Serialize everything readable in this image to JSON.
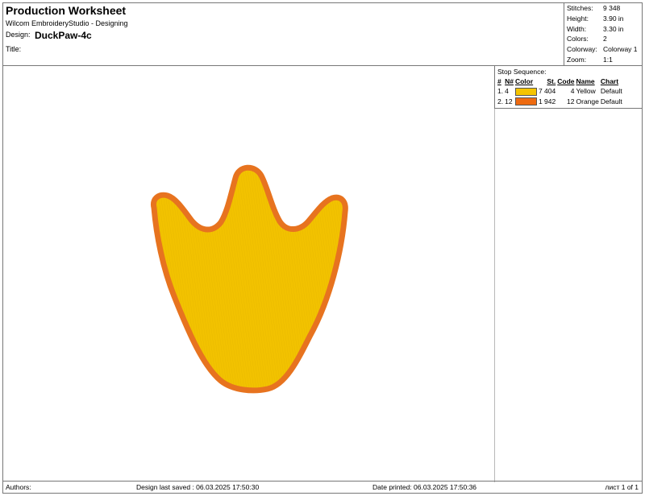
{
  "header": {
    "title": "Production Worksheet",
    "app": "Wilcom EmbroideryStudio - Designing",
    "design_label": "Design:",
    "design_name": "DuckPaw-4c",
    "title_label": "Title:"
  },
  "stats": [
    {
      "label": "Stitches:",
      "value": "9 348"
    },
    {
      "label": "Height:",
      "value": "3.90 in"
    },
    {
      "label": "Width:",
      "value": "3.30 in"
    },
    {
      "label": "Colors:",
      "value": "2"
    },
    {
      "label": "Colorway:",
      "value": "Colorway 1"
    },
    {
      "label": "Zoom:",
      "value": "1:1"
    }
  ],
  "stop_sequence": {
    "title": "Stop Sequence:",
    "headers": {
      "index": "#",
      "number": "N#",
      "color": "Color",
      "stitches": "St.",
      "code": "Code",
      "name": "Name",
      "chart": "Chart"
    },
    "rows": [
      {
        "index": "1.",
        "number": "4",
        "color": "#F5C400",
        "stitches": "7 404",
        "code": "4",
        "name": "Yellow",
        "chart": "Default"
      },
      {
        "index": "2.",
        "number": "12",
        "color": "#EE6A10",
        "stitches": "1 942",
        "code": "12",
        "name": "Orange",
        "chart": "Default"
      }
    ]
  },
  "design": {
    "fill_color": "#F2C200",
    "outline_color": "#E7731F"
  },
  "footer": {
    "authors": "Authors:",
    "saved": "Design last saved : 06.03.2025 17:50:30",
    "printed": "Date printed: 06.03.2025 17:50:36",
    "page": "лист 1 of 1"
  }
}
